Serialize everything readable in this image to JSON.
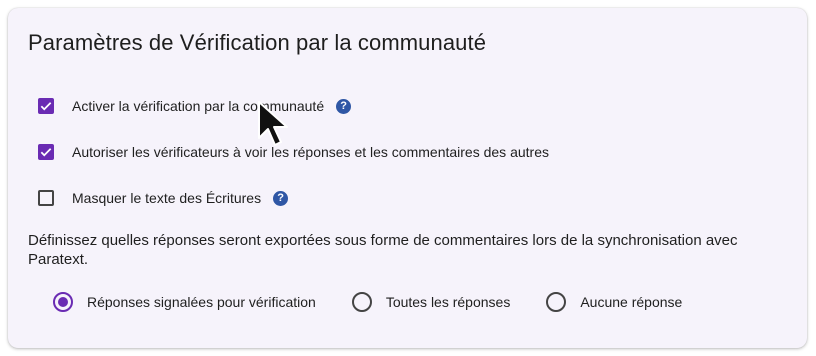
{
  "section": {
    "title": "Paramètres de Vérification par la communauté"
  },
  "options": [
    {
      "label": "Activer la vérification par la communauté",
      "checked": true,
      "help_icon": "help-icon"
    },
    {
      "label": "Autoriser les vérificateurs à voir les réponses et les commentaires des autres",
      "checked": true
    },
    {
      "label": "Masquer le texte des Écritures",
      "checked": false,
      "help_icon": "help-icon"
    }
  ],
  "export": {
    "description": "Définissez quelles réponses seront exportées sous forme de commentaires lors de la synchronisation avec Paratext.",
    "choices": [
      {
        "label": "Réponses signalées pour vérification",
        "selected": true
      },
      {
        "label": "Toutes les réponses",
        "selected": false
      },
      {
        "label": "Aucune réponse",
        "selected": false
      }
    ]
  },
  "help_symbol": "?",
  "colors": {
    "accent": "#6a2bb3",
    "help": "#2f57a5",
    "card_background": "#f6f3fb"
  }
}
